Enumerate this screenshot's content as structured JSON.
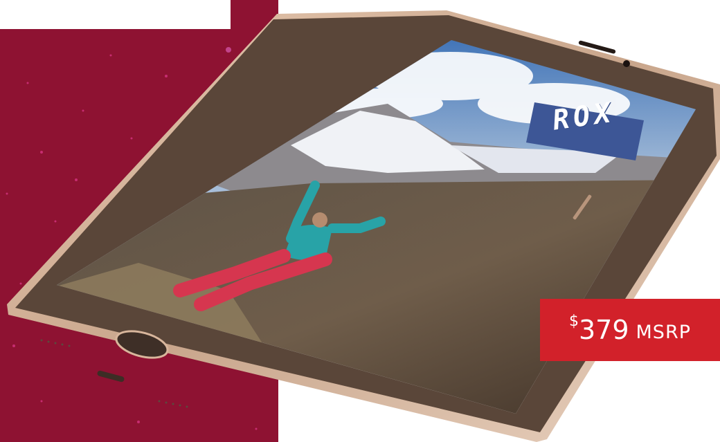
{
  "price": {
    "currency_symbol": "$",
    "amount": "379",
    "suffix": "MSRP"
  },
  "screen_brand": "ROX",
  "colors": {
    "background_maroon": "#8e1232",
    "sparkle_pink": "#e0398c",
    "price_red": "#d2212a",
    "phone_bezel": "#5a4639",
    "phone_frame_gold": "#d9b99f",
    "brand_banner": "#3d5696"
  }
}
